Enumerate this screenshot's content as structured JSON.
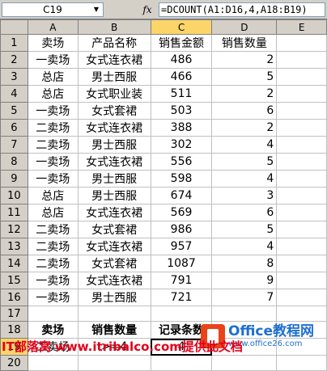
{
  "name_box": "C19",
  "formula": "=DCOUNT(A1:D16,4,A18:B19)",
  "column_headers": [
    "A",
    "B",
    "C",
    "D",
    "E"
  ],
  "rows": [
    {
      "num": "1",
      "cells": [
        "卖场",
        "产品名称",
        "销售金额",
        "销售数量",
        ""
      ]
    },
    {
      "num": "2",
      "cells": [
        "一卖场",
        "女式连衣裙",
        "486",
        "2",
        ""
      ]
    },
    {
      "num": "3",
      "cells": [
        "总店",
        "男士西服",
        "466",
        "5",
        ""
      ]
    },
    {
      "num": "4",
      "cells": [
        "总店",
        "女式职业装",
        "511",
        "2",
        ""
      ]
    },
    {
      "num": "5",
      "cells": [
        "一卖场",
        "女式套裙",
        "503",
        "6",
        ""
      ]
    },
    {
      "num": "6",
      "cells": [
        "二卖场",
        "女式连衣裙",
        "388",
        "2",
        ""
      ]
    },
    {
      "num": "7",
      "cells": [
        "二卖场",
        "男士西服",
        "302",
        "4",
        ""
      ]
    },
    {
      "num": "8",
      "cells": [
        "一卖场",
        "女式连衣裙",
        "556",
        "5",
        ""
      ]
    },
    {
      "num": "9",
      "cells": [
        "一卖场",
        "男士西服",
        "598",
        "4",
        ""
      ]
    },
    {
      "num": "10",
      "cells": [
        "总店",
        "男士西服",
        "674",
        "3",
        ""
      ]
    },
    {
      "num": "11",
      "cells": [
        "总店",
        "女式连衣裙",
        "569",
        "6",
        ""
      ]
    },
    {
      "num": "12",
      "cells": [
        "二卖场",
        "女式套裙",
        "986",
        "5",
        ""
      ]
    },
    {
      "num": "13",
      "cells": [
        "二卖场",
        "女式连衣裙",
        "957",
        "4",
        ""
      ]
    },
    {
      "num": "14",
      "cells": [
        "二卖场",
        "女式套裙",
        "1087",
        "8",
        ""
      ]
    },
    {
      "num": "15",
      "cells": [
        "一卖场",
        "女式连衣裙",
        "791",
        "9",
        ""
      ]
    },
    {
      "num": "16",
      "cells": [
        "一卖场",
        "男士西服",
        "721",
        "7",
        ""
      ]
    },
    {
      "num": "17",
      "cells": [
        "",
        "",
        "",
        "",
        ""
      ]
    },
    {
      "num": "18",
      "cells": [
        "卖场",
        "销售数量",
        "记录条数",
        "",
        ""
      ]
    },
    {
      "num": "19",
      "cells": [
        "二卖场",
        ">=4",
        "4",
        "",
        ""
      ]
    },
    {
      "num": "20",
      "cells": [
        "",
        "",
        "",
        "",
        ""
      ]
    }
  ],
  "watermark": {
    "logo_icon": "office-logo-icon",
    "title": "Office教程网",
    "url": "www.office26.com"
  },
  "footer_credit": "IT部落窝 www.itribalco.com提供此文档"
}
